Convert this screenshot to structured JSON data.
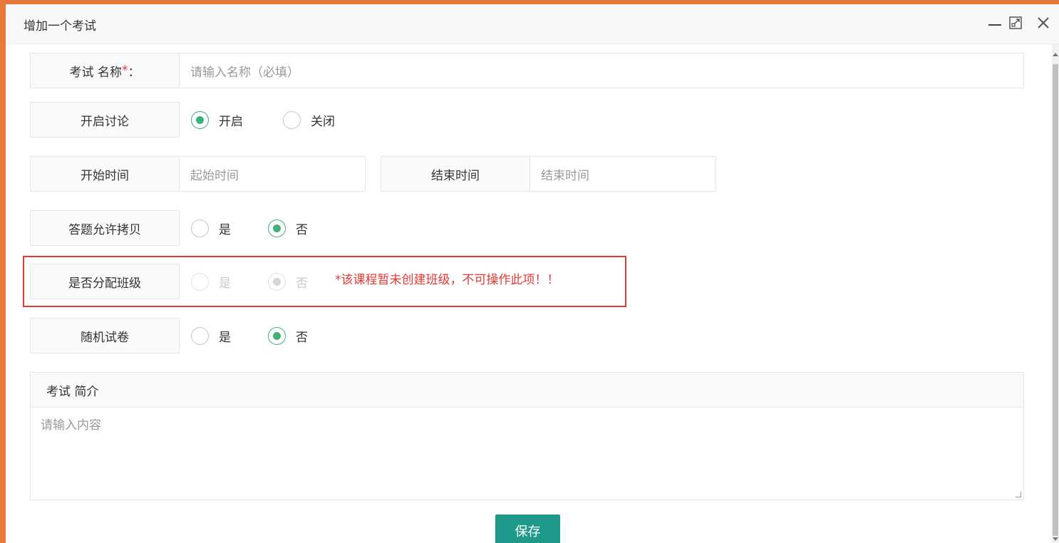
{
  "dialog": {
    "title": "增加一个考试"
  },
  "form": {
    "name_label": "考试 名称",
    "name_required_mark": "*",
    "name_colon": "：",
    "name_placeholder": "请输入名称（必填）",
    "discussion_label": "开启讨论",
    "discussion_options": [
      "开启",
      "关闭"
    ],
    "discussion_selected": "开启",
    "start_label": "开始时间",
    "start_placeholder": "起始时间",
    "end_label": "结束时间",
    "end_placeholder": "结束时间",
    "copy_label": "答题允许拷贝",
    "copy_options": [
      "是",
      "否"
    ],
    "copy_selected": "否",
    "class_label": "是否分配班级",
    "class_options": [
      "是",
      "否"
    ],
    "class_selected": "否",
    "class_warning": "*该课程暂未创建班级，不可操作此项！！",
    "random_label": "随机试卷",
    "random_options": [
      "是",
      "否"
    ],
    "random_selected": "否",
    "intro_label": "考试 简介",
    "intro_placeholder": "请输入内容",
    "save_label": "保存"
  },
  "colors": {
    "accent_green": "#3fb07a",
    "save_button": "#1f9a8a",
    "warning_red": "#e53935",
    "window_border": "#e8773a"
  },
  "icons": [
    "minimize-icon",
    "maximize-icon",
    "close-icon"
  ]
}
